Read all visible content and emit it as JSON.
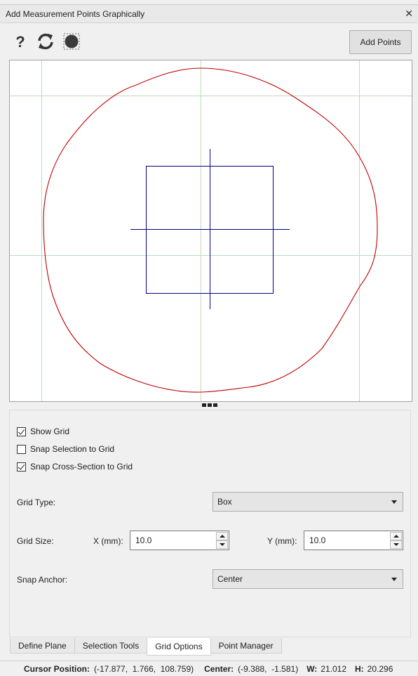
{
  "window": {
    "title": "Add Measurement Points Graphically",
    "close_glyph": "✕"
  },
  "toolbar": {
    "icons": [
      "help-icon",
      "refresh-icon",
      "record-circle-icon"
    ],
    "add_points_label": "Add Points"
  },
  "colors": {
    "outline": "#c00000",
    "selection": "#00008b",
    "grid": "#b9dcb9"
  },
  "options": {
    "show_grid": {
      "label": "Show Grid",
      "checked": true
    },
    "snap_selection": {
      "label": "Snap Selection to Grid",
      "checked": false
    },
    "snap_cross_section": {
      "label": "Snap Cross-Section to Grid",
      "checked": true
    },
    "grid_type": {
      "label": "Grid Type:",
      "value": "Box"
    },
    "grid_size": {
      "label": "Grid Size:",
      "x_label": "X (mm):",
      "x_value": "10.0",
      "y_label": "Y (mm):",
      "y_value": "10.0"
    },
    "snap_anchor": {
      "label": "Snap Anchor:",
      "value": "Center"
    }
  },
  "tabs": [
    {
      "label": "Define Plane",
      "active": false
    },
    {
      "label": "Selection Tools",
      "active": false
    },
    {
      "label": "Grid Options",
      "active": true
    },
    {
      "label": "Point Manager",
      "active": false
    }
  ],
  "status": {
    "cursor_label": "Cursor Position:",
    "cursor_value": "(-17.877,  1.766,  108.759)",
    "center_label": "Center:",
    "center_value": "(-9.388,  -1.581)",
    "w_label": "W:",
    "w_value": "21.012",
    "h_label": "H:",
    "h_value": "20.296"
  }
}
